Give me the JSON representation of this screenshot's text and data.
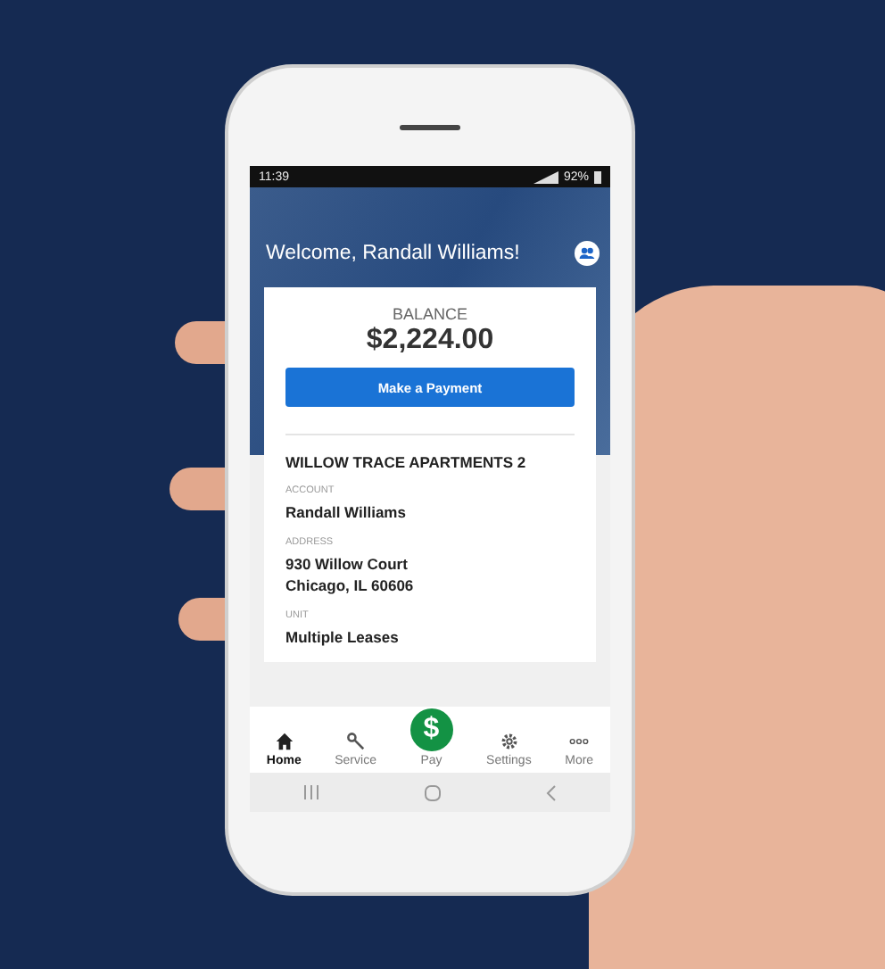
{
  "status_bar": {
    "time": "11:39",
    "battery": "92%"
  },
  "header": {
    "greeting": "Welcome, Randall Williams!"
  },
  "balance_card": {
    "label": "BALANCE",
    "amount": "$2,224.00",
    "button": "Make a Payment"
  },
  "property": {
    "name": "WILLOW TRACE APARTMENTS 2",
    "fields": [
      {
        "label": "ACCOUNT",
        "lines": [
          "Randall Williams"
        ]
      },
      {
        "label": "ADDRESS",
        "lines": [
          "930 Willow Court",
          "Chicago, IL 60606"
        ]
      },
      {
        "label": "UNIT",
        "lines": [
          "Multiple Leases"
        ]
      }
    ]
  },
  "tab_bar": [
    {
      "kind": "home",
      "label": "Home",
      "selected": true
    },
    {
      "kind": "service",
      "label": "Service",
      "selected": false
    },
    {
      "kind": "pay",
      "label": "Pay",
      "symbol": "$",
      "selected": false
    },
    {
      "kind": "settings",
      "label": "Settings",
      "selected": false
    },
    {
      "kind": "more",
      "label": "More",
      "selected": false
    }
  ]
}
